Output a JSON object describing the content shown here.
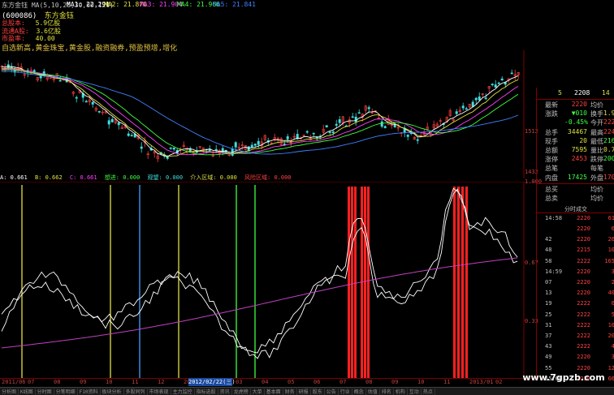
{
  "header": {
    "ma_line": "东方金钰 MA(5,10,20,30,60,120)",
    "ma_values": [
      {
        "label": "MA1: 22.291",
        "color": "#ffffff"
      },
      {
        "label": "MA2: 21.870",
        "color": "#e0e040"
      },
      {
        "label": "MA3: 21.904",
        "color": "#ff40ff"
      },
      {
        "label": "MA4: 21.966",
        "color": "#40ff40"
      },
      {
        "label": "MA5: 21.841",
        "color": "#4080ff"
      }
    ]
  },
  "title": {
    "code": "(600086)",
    "name": "东方金钰"
  },
  "info": [
    {
      "label": "总股本:",
      "value": "5.9亿股"
    },
    {
      "label": "流通A股:",
      "value": "3.6亿股"
    },
    {
      "label": "市盈率:",
      "value": "40.00"
    }
  ],
  "notes": "自选新高,黄金珠宝,黄金股,融资融券,预盈预增,增化",
  "main_axis": {
    "right_top": "1512",
    "right_bottom": "1432"
  },
  "indicator_header": [
    {
      "text": "A: 0.661",
      "color": "#ffffff"
    },
    {
      "text": "B: 0.662",
      "color": "#e0e040"
    },
    {
      "text": "C: 0.661",
      "color": "#ff40ff"
    },
    {
      "text": "想进: 0.000",
      "color": "#40ff40"
    },
    {
      "text": "观望: 0.000",
      "color": "#40e0e0"
    },
    {
      "text": "介入区域: 0.000",
      "color": "#e0e040"
    },
    {
      "text": "风险区域: 0.000",
      "color": "#ff4040"
    }
  ],
  "indicator_axis": {
    "top": "1.000",
    "mid": "0.67",
    "low": "0.33"
  },
  "date_axis": [
    "2011/06",
    "07",
    "08",
    "09",
    "10",
    "11",
    "12",
    "2012/01",
    "02",
    "03",
    "04",
    "05",
    "06",
    "07",
    "08",
    "09",
    "10",
    "11",
    "2013/01",
    "02"
  ],
  "date_highlight": "2012/02/22(三)",
  "tabs": [
    "分析图",
    "K线图",
    "分时图",
    "分笔明细",
    "F10资料",
    "板块分析",
    "多股同列",
    "市场表现",
    "主力监控",
    "指标选股",
    "资讯",
    "龙虎榜",
    "大单",
    "基本面",
    "财务",
    "研报",
    "股东",
    "公告",
    "行业",
    "概念",
    "估值",
    "排名",
    "机构",
    "互动",
    "热点"
  ],
  "right_panel": {
    "top": {
      "code": "5",
      "v1": "2208",
      "v2": "14"
    },
    "rows": [
      {
        "l1": "最新",
        "v1": "2220",
        "l2": "均价",
        "v2": ""
      },
      {
        "l1": "涨跌",
        "v1": "▼010",
        "l2": "换手",
        "v2": "1.96%"
      },
      {
        "l1": "",
        "v1": "-0.45%",
        "l2": "今开",
        "v2": "2220"
      },
      {
        "l1": "总手",
        "v1": "34467",
        "l2": "最高",
        "v2": "2240"
      },
      {
        "l1": "现手",
        "v1": "20",
        "l2": "最低",
        "v2": "2168"
      },
      {
        "l1": "总额",
        "v1": "7595",
        "l2": "量比",
        "v2": "0.72"
      },
      {
        "l1": "涨停",
        "v1": "2453",
        "l2": "跌停",
        "v2": "2007"
      },
      {
        "l1": "总笔",
        "v1": "",
        "l2": "每笔",
        "v2": ""
      },
      {
        "l1": "内盘",
        "v1": "17425",
        "l2": "外盘",
        "v2": "17042"
      }
    ],
    "buy_sell": [
      {
        "l1": "总买",
        "l2": "均价"
      },
      {
        "l1": "总卖",
        "l2": "均价"
      }
    ],
    "trade_header": "分时成交",
    "trades": [
      {
        "time": "14:58",
        "price": "2220",
        "vol": "61"
      },
      {
        "time": "",
        "price": "2220",
        "vol": "6"
      },
      {
        "time": "42",
        "price": "2220",
        "vol": "26"
      },
      {
        "time": "48",
        "price": "2215",
        "vol": "10"
      },
      {
        "time": "58",
        "price": "2222",
        "vol": "165"
      },
      {
        "time": "14:59",
        "price": "2220",
        "vol": "3"
      },
      {
        "time": "07",
        "price": "2220",
        "vol": "2"
      },
      {
        "time": "13",
        "price": "2220",
        "vol": "40"
      },
      {
        "time": "19",
        "price": "2222",
        "vol": "6"
      },
      {
        "time": "25",
        "price": "2222",
        "vol": "5"
      },
      {
        "time": "31",
        "price": "2222",
        "vol": "10"
      },
      {
        "time": "37",
        "price": "2222",
        "vol": "20"
      },
      {
        "time": "43",
        "price": "2222",
        "vol": "4"
      },
      {
        "time": "49",
        "price": "2220",
        "vol": "3"
      },
      {
        "time": "55",
        "price": "2220",
        "vol": "12"
      },
      {
        "time": "15:00",
        "price": "2220",
        "vol": "66"
      }
    ]
  },
  "watermark": "www.7gpzb.com",
  "chart_colors": {
    "candle_up": "#ff4040",
    "candle_down": "#40e0e0",
    "ma5": "#ffffff",
    "ma10": "#e0e040",
    "ma20": "#ff40ff",
    "ma30": "#40ff40",
    "ma60": "#4080ff",
    "signal_red": "#ff2020"
  }
}
